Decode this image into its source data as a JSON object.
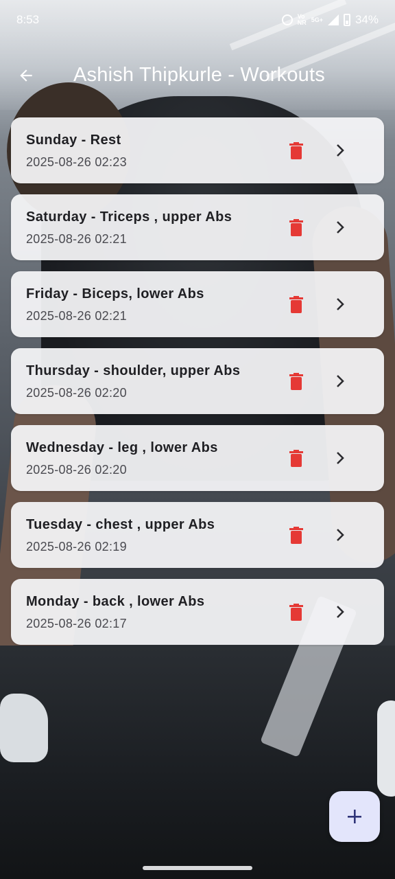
{
  "status_bar": {
    "time": "8:53",
    "network_top": "Vo",
    "network_bottom": "NR",
    "network_type": "5G+",
    "battery_text": "34%",
    "icons": [
      "alarm-icon",
      "signal-icon",
      "battery-icon"
    ]
  },
  "app_bar": {
    "title": "Ashish Thipkurle - Workouts",
    "back_icon": "arrow-left-icon"
  },
  "workouts": [
    {
      "name": "Sunday - Rest",
      "date": "2025-08-26 02:23"
    },
    {
      "name": "Saturday - Triceps , upper Abs",
      "date": "2025-08-26 02:21"
    },
    {
      "name": "Friday - Biceps, lower Abs",
      "date": "2025-08-26 02:21"
    },
    {
      "name": "Thursday - shoulder, upper Abs",
      "date": "2025-08-26 02:20"
    },
    {
      "name": "Wednesday - leg , lower Abs",
      "date": "2025-08-26 02:20"
    },
    {
      "name": "Tuesday - chest , upper Abs",
      "date": "2025-08-26 02:19"
    },
    {
      "name": "Monday - back , lower Abs",
      "date": "2025-08-26 02:17"
    }
  ],
  "item_icons": {
    "delete": "trash-icon",
    "open": "chevron-right-icon"
  },
  "fab": {
    "icon": "plus-icon"
  },
  "colors": {
    "delete": "#e53935",
    "card_bg": "#f6f6f9",
    "fab_bg": "#e3e5fb",
    "fab_icon": "#3a3f8f"
  }
}
